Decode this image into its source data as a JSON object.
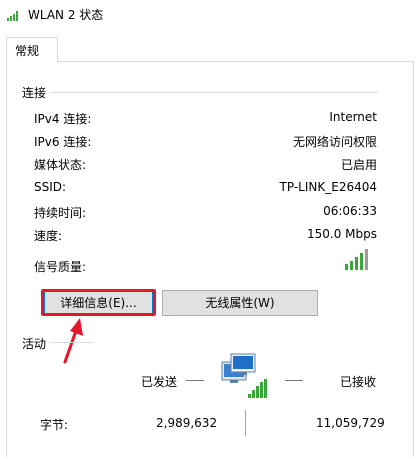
{
  "window": {
    "title": "WLAN 2 状态",
    "icon": "wifi-signal-icon"
  },
  "tabs": [
    {
      "label": "常规"
    }
  ],
  "connection": {
    "group_label": "连接",
    "rows": [
      {
        "label": "IPv4 连接:",
        "value": "Internet"
      },
      {
        "label": "IPv6 连接:",
        "value": "无网络访问权限"
      },
      {
        "label": "媒体状态:",
        "value": "已启用"
      },
      {
        "label": "SSID:",
        "value": "TP-LINK_E26404"
      },
      {
        "label": "持续时间:",
        "value": "06:06:33"
      },
      {
        "label": "速度:",
        "value": "150.0 Mbps"
      }
    ],
    "signal_label": "信号质量:",
    "signal_bars_level": 4,
    "signal_bars_total": 5
  },
  "buttons": {
    "details": "详细信息(E)...",
    "wireless_properties": "无线属性(W)"
  },
  "activity": {
    "group_label": "活动",
    "sent_label": "已发送",
    "received_label": "已接收",
    "bytes_label": "字节:",
    "bytes_sent": "2,989,632",
    "bytes_received": "11,059,729",
    "icon": "network-computer-icon"
  },
  "colors": {
    "highlight": "#e3182d",
    "signal": "#3aa63a",
    "focus": "#0078d7"
  }
}
